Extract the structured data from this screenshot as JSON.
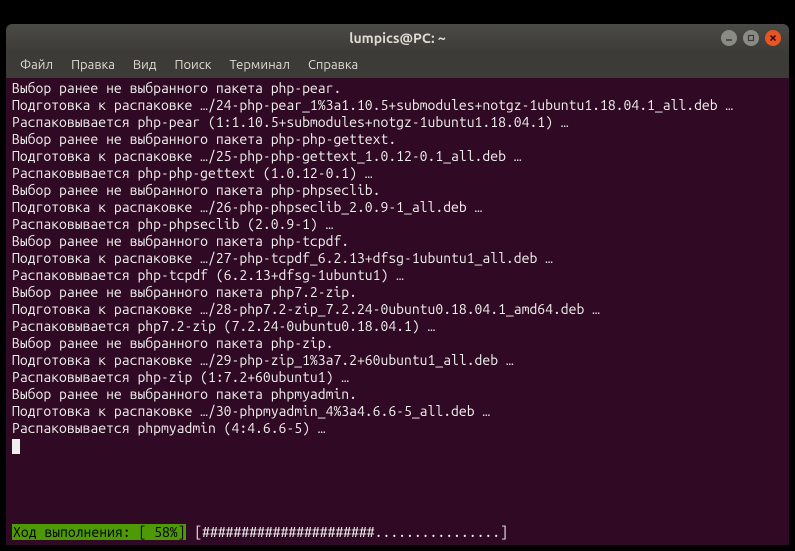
{
  "window": {
    "title": "lumpics@PC: ~"
  },
  "menu": {
    "file": "Файл",
    "edit": "Правка",
    "view": "Вид",
    "search": "Поиск",
    "terminal": "Терминал",
    "help": "Справка"
  },
  "lines": [
    "Выбор ранее не выбранного пакета php-pear.",
    "Подготовка к распаковке …/24-php-pear_1%3a1.10.5+submodules+notgz-1ubuntu1.18.04.1_all.deb …",
    "Распаковывается php-pear (1:1.10.5+submodules+notgz-1ubuntu1.18.04.1) …",
    "Выбор ранее не выбранного пакета php-php-gettext.",
    "Подготовка к распаковке …/25-php-php-gettext_1.0.12-0.1_all.deb …",
    "Распаковывается php-php-gettext (1.0.12-0.1) …",
    "Выбор ранее не выбранного пакета php-phpseclib.",
    "Подготовка к распаковке …/26-php-phpseclib_2.0.9-1_all.deb …",
    "Распаковывается php-phpseclib (2.0.9-1) …",
    "Выбор ранее не выбранного пакета php-tcpdf.",
    "Подготовка к распаковке …/27-php-tcpdf_6.2.13+dfsg-1ubuntu1_all.deb …",
    "Распаковывается php-tcpdf (6.2.13+dfsg-1ubuntu1) …",
    "Выбор ранее не выбранного пакета php7.2-zip.",
    "Подготовка к распаковке …/28-php7.2-zip_7.2.24-0ubuntu0.18.04.1_amd64.deb …",
    "Распаковывается php7.2-zip (7.2.24-0ubuntu0.18.04.1) …",
    "Выбор ранее не выбранного пакета php-zip.",
    "Подготовка к распаковке …/29-php-zip_1%3a7.2+60ubuntu1_all.deb …",
    "Распаковывается php-zip (1:7.2+60ubuntu1) …",
    "Выбор ранее не выбранного пакета phpmyadmin.",
    "Подготовка к распаковке …/30-phpmyadmin_4%3a4.6.6-5_all.deb …",
    "Распаковывается phpmyadmin (4:4.6.6-5) …"
  ],
  "progress": {
    "label": "Ход выполнения: [  58%]",
    "bar": " [######################................] "
  }
}
